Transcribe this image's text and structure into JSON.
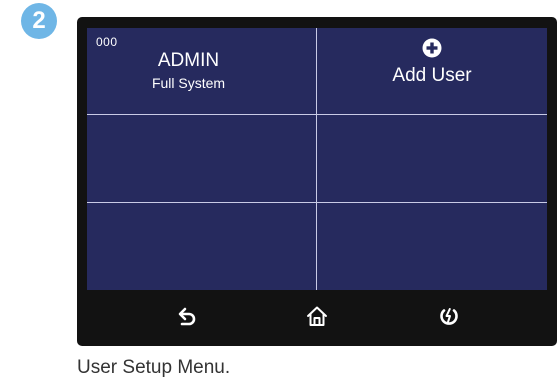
{
  "step": {
    "number": "2",
    "color": "#6fb6e6"
  },
  "screen": {
    "background": "#262a5e",
    "users": [
      {
        "id": "000",
        "name": "ADMIN",
        "role": "Full System"
      }
    ],
    "add_user": {
      "icon": "plus-circle-icon",
      "label": "Add User"
    }
  },
  "navbar": {
    "buttons": [
      {
        "icon": "back-arrow-icon"
      },
      {
        "icon": "home-icon"
      },
      {
        "icon": "power-icon"
      }
    ]
  },
  "caption": "User Setup Menu."
}
